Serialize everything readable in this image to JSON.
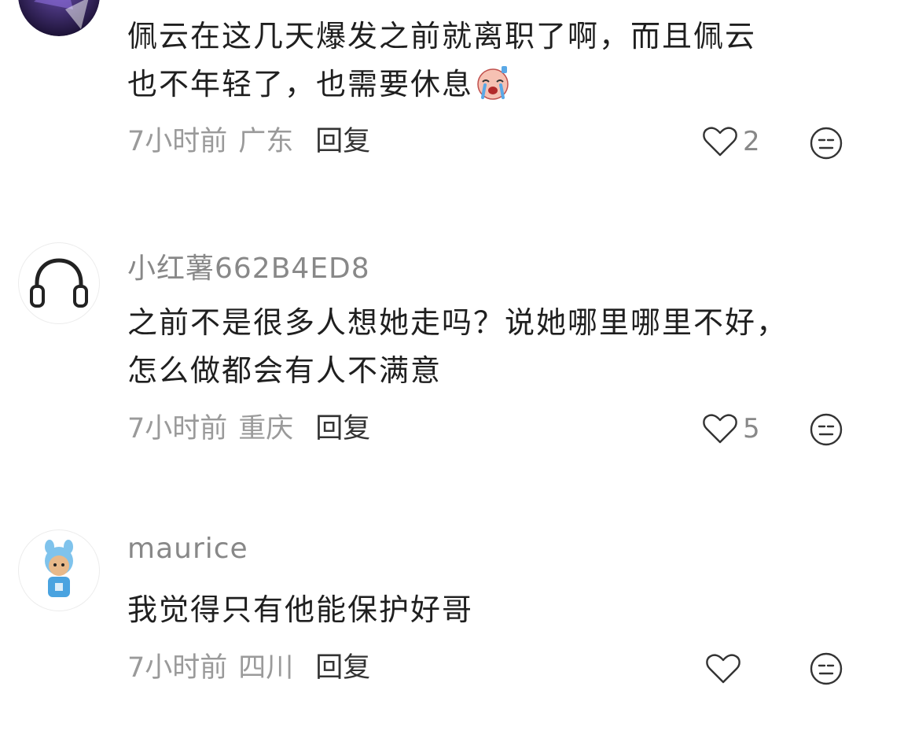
{
  "comments": [
    {
      "username": "",
      "lines": [
        "佩云在这几天爆发之前就离职了啊，而且佩云",
        "也不年轻了，也需要休息"
      ],
      "time": "7小时前",
      "location": "广东",
      "reply_label": "回复",
      "likes": "2",
      "emoji_icon": "crying-face-icon"
    },
    {
      "username": "小红薯662B4ED8",
      "lines": [
        "之前不是很多人想她走吗？说她哪里哪里不好，",
        "怎么做都会有人不满意"
      ],
      "time": "7小时前",
      "location": "重庆",
      "reply_label": "回复",
      "likes": "5"
    },
    {
      "username": "maurice",
      "lines": [
        "我觉得只有他能保护好哥"
      ],
      "time": "7小时前",
      "location": "四川",
      "reply_label": "回复",
      "likes": ""
    }
  ],
  "colors": {
    "username": "#888888",
    "meta": "#9a9a9a",
    "text": "#1f1f1f",
    "icon_stroke": "#333333"
  }
}
